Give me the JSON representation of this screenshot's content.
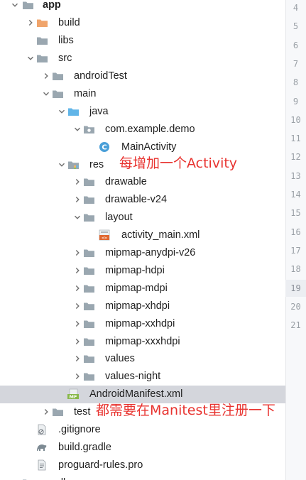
{
  "tree": {
    "rows": [
      {
        "label": "app",
        "icon": "folder-gray-icon",
        "chevron": "down",
        "bold": true,
        "x": 0
      },
      {
        "label": "build",
        "icon": "folder-orange-icon",
        "chevron": "right",
        "x": 1
      },
      {
        "label": "libs",
        "icon": "folder-gray-icon",
        "chevron": "",
        "x": 1
      },
      {
        "label": "src",
        "icon": "folder-gray-icon",
        "chevron": "down",
        "x": 1
      },
      {
        "label": "androidTest",
        "icon": "folder-gray-icon",
        "chevron": "right",
        "x": 2
      },
      {
        "label": "main",
        "icon": "folder-gray-icon",
        "chevron": "down",
        "x": 2
      },
      {
        "label": "java",
        "icon": "folder-blue-icon",
        "chevron": "down",
        "x": 3
      },
      {
        "label": "com.example.demo",
        "icon": "package-icon",
        "chevron": "down",
        "x": 4
      },
      {
        "label": "MainActivity",
        "icon": "class-icon",
        "chevron": "",
        "x": 5
      },
      {
        "label": "res",
        "icon": "folder-resources-icon",
        "chevron": "down",
        "x": 3
      },
      {
        "label": "drawable",
        "icon": "folder-gray-icon",
        "chevron": "right",
        "x": 4
      },
      {
        "label": "drawable-v24",
        "icon": "folder-gray-icon",
        "chevron": "right",
        "x": 4
      },
      {
        "label": "layout",
        "icon": "folder-gray-icon",
        "chevron": "down",
        "x": 4
      },
      {
        "label": "activity_main.xml",
        "icon": "layout-xml-icon",
        "chevron": "",
        "x": 5
      },
      {
        "label": "mipmap-anydpi-v26",
        "icon": "folder-gray-icon",
        "chevron": "right",
        "x": 4
      },
      {
        "label": "mipmap-hdpi",
        "icon": "folder-gray-icon",
        "chevron": "right",
        "x": 4
      },
      {
        "label": "mipmap-mdpi",
        "icon": "folder-gray-icon",
        "chevron": "right",
        "x": 4
      },
      {
        "label": "mipmap-xhdpi",
        "icon": "folder-gray-icon",
        "chevron": "right",
        "x": 4
      },
      {
        "label": "mipmap-xxhdpi",
        "icon": "folder-gray-icon",
        "chevron": "right",
        "x": 4
      },
      {
        "label": "mipmap-xxxhdpi",
        "icon": "folder-gray-icon",
        "chevron": "right",
        "x": 4
      },
      {
        "label": "values",
        "icon": "folder-gray-icon",
        "chevron": "right",
        "x": 4
      },
      {
        "label": "values-night",
        "icon": "folder-gray-icon",
        "chevron": "right",
        "x": 4
      },
      {
        "label": "AndroidManifest.xml",
        "icon": "manifest-icon",
        "chevron": "",
        "x": 3,
        "selected": true
      },
      {
        "label": "test",
        "icon": "folder-gray-icon",
        "chevron": "right",
        "x": 2
      },
      {
        "label": ".gitignore",
        "icon": "gitignore-icon",
        "chevron": "",
        "x": 1
      },
      {
        "label": "build.gradle",
        "icon": "gradle-icon",
        "chevron": "",
        "x": 1
      },
      {
        "label": "proguard-rules.pro",
        "icon": "text-file-icon",
        "chevron": "",
        "x": 1
      },
      {
        "label": "gradle",
        "icon": "folder-gray-icon",
        "chevron": "right",
        "x": 0
      }
    ]
  },
  "annotations": [
    {
      "text": "每增加一个Activity",
      "row": 9
    },
    {
      "text": "都需要在Manitest里注册一下",
      "row": 23
    }
  ],
  "gutter": {
    "line_numbers": [
      "4",
      "5",
      "6",
      "7",
      "8",
      "9",
      "10",
      "11",
      "12",
      "13",
      "14",
      "15",
      "16",
      "17",
      "18",
      "19",
      "20",
      "21"
    ],
    "current_line": "19"
  },
  "colors": {
    "annotation": "#e8332f",
    "selection": "#d4d6dc",
    "folder": "#9aa7b0",
    "build_folder": "#f0a46b",
    "java_folder": "#61b5e8"
  }
}
